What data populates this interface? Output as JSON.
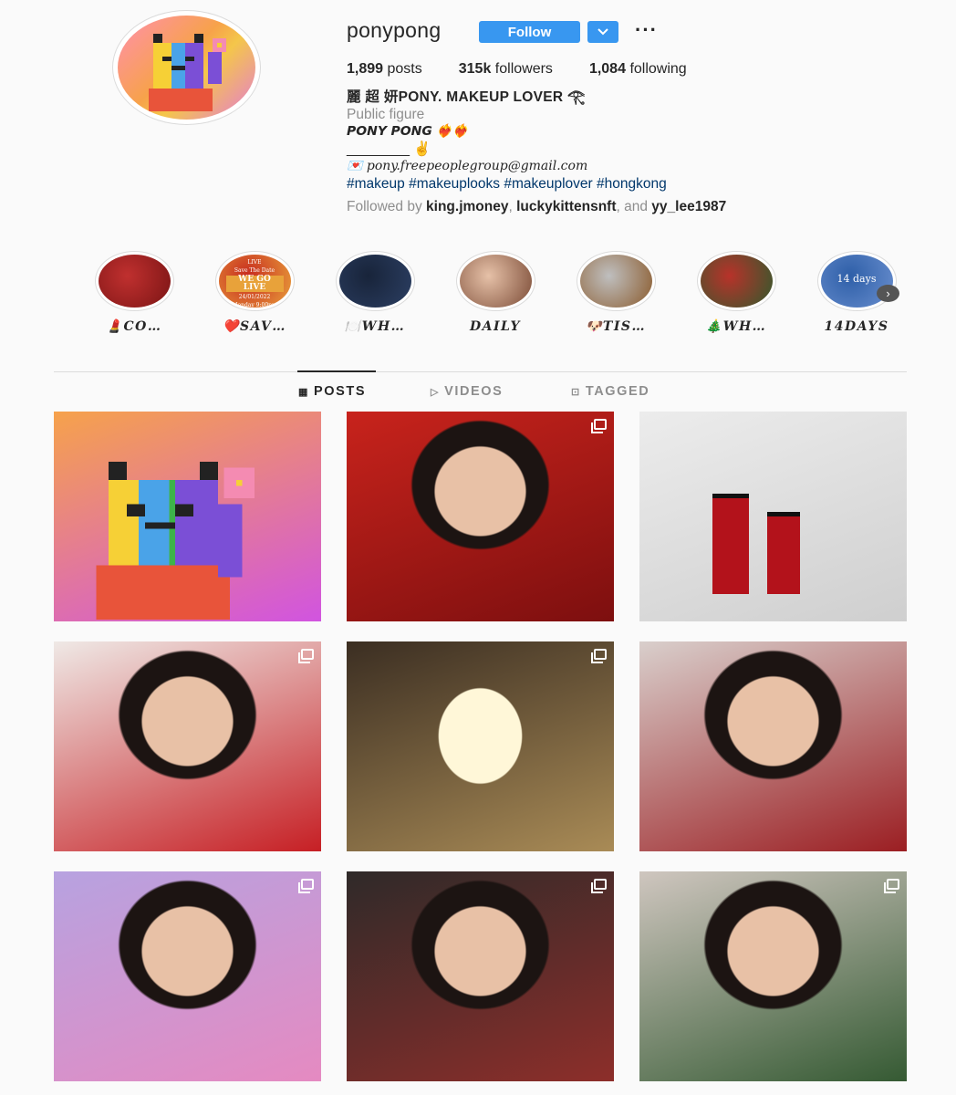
{
  "profile": {
    "username": "ponypong",
    "follow_label": "Follow",
    "more_label": "···",
    "stats": {
      "posts_count": "1,899",
      "posts_label": "posts",
      "followers_count": "315k",
      "followers_label": "followers",
      "following_count": "1,084",
      "following_label": "following"
    },
    "bio": {
      "name": "麗 超 妍PONY. MAKEUP LOVER 𓂀",
      "category": "Public figure",
      "line1": "𝙋𝙊𝙉𝙔 𝙋𝙊𝙉𝙂 ❤️‍🔥❤️‍🔥",
      "line2": "________ ✌",
      "email": "💌 pony.freepeoplegroup@gmail.com",
      "hashtags": "#makeup #makeuplooks #makeuplover #hongkong",
      "followed_by_prefix": "Followed by",
      "followed_by_1": "king.jmoney",
      "followed_by_2": "luckykittensnft",
      "followed_by_and": "and",
      "followed_by_3": "yy_lee1987"
    }
  },
  "highlights": [
    {
      "label": "💄CO…",
      "colors": [
        "#c0302f",
        "#7a1414"
      ]
    },
    {
      "label": "❤️SAV…",
      "colors": [
        "#c72a1f",
        "#e9a23b"
      ],
      "inner": [
        "LIVE",
        "Save The Date",
        "WE GO LIVE",
        "24/01/2022",
        "Monday 9:00pm"
      ]
    },
    {
      "label": "🍽️WH…",
      "colors": [
        "#18243a",
        "#2c3f63"
      ]
    },
    {
      "label": "DAILY",
      "colors": [
        "#e6c1a8",
        "#7a4a35"
      ]
    },
    {
      "label": "🐶TIS…",
      "colors": [
        "#bfbfbf",
        "#8a5a2c"
      ]
    },
    {
      "label": "🎄WH…",
      "colors": [
        "#b8322a",
        "#2f5a2d"
      ]
    },
    {
      "label": "14DAYS",
      "colors": [
        "#2e5fa8",
        "#6a8fcf"
      ],
      "inner": [
        "14 days"
      ]
    }
  ],
  "tabs": [
    {
      "label": "POSTS",
      "icon": "grid-icon",
      "active": true
    },
    {
      "label": "VIDEOS",
      "icon": "play-icon",
      "active": false
    },
    {
      "label": "TAGGED",
      "icon": "tag-icon",
      "active": false
    }
  ],
  "posts": [
    {
      "kind": "pixel-cat",
      "multi": false,
      "colors": [
        "#f6a24b",
        "#d154e0"
      ]
    },
    {
      "kind": "portrait-red",
      "multi": true,
      "colors": [
        "#c8231c",
        "#7d0f0f"
      ]
    },
    {
      "kind": "chanel",
      "multi": false,
      "colors": [
        "#ececec",
        "#cfcfcf"
      ]
    },
    {
      "kind": "portrait",
      "multi": true,
      "colors": [
        "#efe9e6",
        "#c61f24"
      ]
    },
    {
      "kind": "candle",
      "multi": true,
      "colors": [
        "#3b2e22",
        "#a98b56"
      ]
    },
    {
      "kind": "mirror-selfie",
      "multi": false,
      "colors": [
        "#d9cfcc",
        "#9b1e22"
      ]
    },
    {
      "kind": "portrait-purple",
      "multi": true,
      "colors": [
        "#b7a2e0",
        "#e58ac1"
      ]
    },
    {
      "kind": "portrait-drink",
      "multi": true,
      "colors": [
        "#2f2a29",
        "#8d2e2a"
      ]
    },
    {
      "kind": "green-dress",
      "multi": true,
      "colors": [
        "#cfc6bf",
        "#355a33"
      ]
    }
  ]
}
